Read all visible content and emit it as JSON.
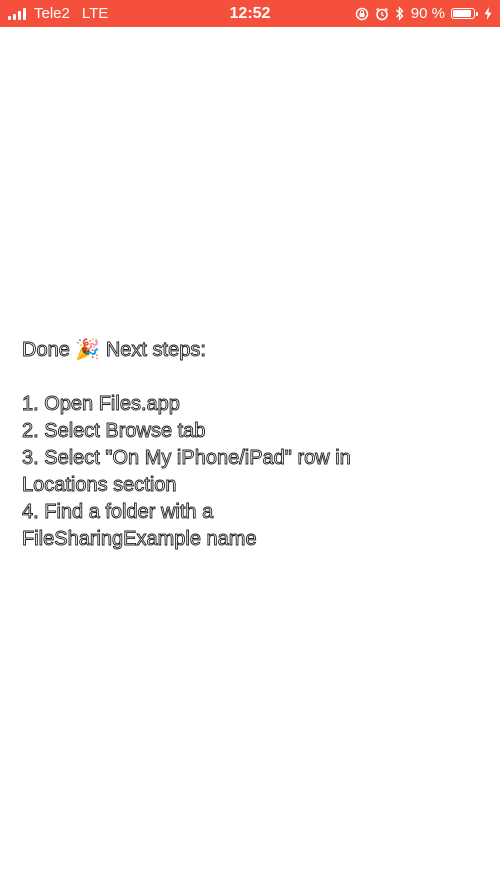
{
  "status_bar": {
    "carrier": "Tele2",
    "network": "LTE",
    "time": "12:52",
    "battery_percent_text": "90 %",
    "battery_level": 0.9,
    "icons": [
      "signal-icon",
      "rotation-lock-icon",
      "alarm-icon",
      "bluetooth-icon",
      "battery-icon",
      "charging-icon"
    ],
    "background_color": "#f4503b"
  },
  "message": {
    "heading_prefix": "Done",
    "heading_emoji": "🎉",
    "heading_suffix": "Next steps:",
    "steps": [
      "1. Open Files.app",
      "2. Select Browse tab",
      "3. Select \"On My iPhone/iPad\" row in",
      "Locations section",
      "4. Find a folder with a",
      "FileSharingExample name"
    ]
  }
}
